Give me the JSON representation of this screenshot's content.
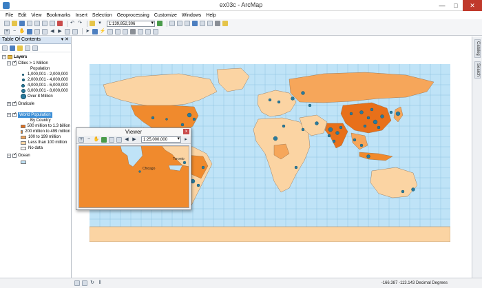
{
  "window": {
    "title": "ex03c - ArcMap",
    "minimize": "—",
    "maximize": "□",
    "close": "✕"
  },
  "menu": [
    "File",
    "Edit",
    "View",
    "Bookmarks",
    "Insert",
    "Selection",
    "Geoprocessing",
    "Customize",
    "Windows",
    "Help"
  ],
  "toolbar": {
    "scale": "1:139,852,306"
  },
  "toc": {
    "title": "Table Of Contents",
    "pin": "▾ ✕",
    "layers_label": "Layers",
    "cities_layer": "Cities > 1 Million",
    "population_heading": "Population",
    "city_classes": [
      {
        "label": "1,000,001 - 2,000,000",
        "size": 3
      },
      {
        "label": "2,000,001 - 4,000,000",
        "size": 4
      },
      {
        "label": "4,000,001 - 6,000,000",
        "size": 5
      },
      {
        "label": "6,000,001 - 8,000,000",
        "size": 6
      },
      {
        "label": "Over 8 Million",
        "size": 8
      }
    ],
    "graticule_layer": "Graticule",
    "world_pop_layer": "World Population",
    "by_country": "By Country",
    "pop_classes": [
      {
        "label": "500 million to 1.3 billion",
        "color": "#e8701a"
      },
      {
        "label": "200 million to 499 million",
        "color": "#f08a2d"
      },
      {
        "label": "100 to 199 million",
        "color": "#f6a65a"
      },
      {
        "label": "Less than 100 million",
        "color": "#fbd4a3"
      },
      {
        "label": "No data",
        "color": "#ffffff"
      }
    ],
    "ocean_layer": "Ocean",
    "ocean_color": "#bfe3f7"
  },
  "right_tabs": {
    "catalog": "Catalog",
    "search": "Search"
  },
  "viewer": {
    "title": "Viewer",
    "close": "x",
    "scale": "1:25,000,000",
    "labels": {
      "chicago": "Chicago",
      "toronto": "Toronto"
    }
  },
  "status": {
    "coords": "-166.387  -113.143 Decimal Degrees"
  },
  "map_colors": {
    "ocean": "#bfe3f7",
    "high": "#e8701a",
    "mid": "#f08a2d",
    "low": "#fbd4a3",
    "city": "#2a7a9c"
  }
}
